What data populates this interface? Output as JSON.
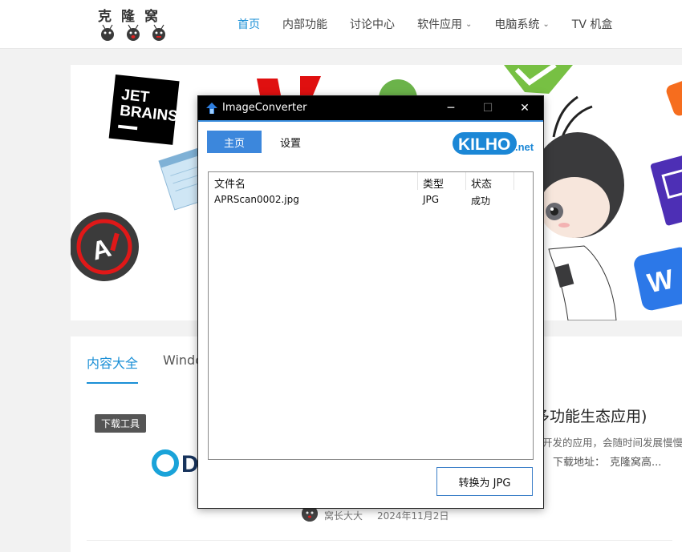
{
  "site": {
    "logo_text": "克隆窝",
    "nav": [
      {
        "label": "首页",
        "active": true
      },
      {
        "label": "内部功能"
      },
      {
        "label": "讨论中心"
      },
      {
        "label": "软件应用",
        "dropdown": true
      },
      {
        "label": "电脑系统",
        "dropdown": true
      },
      {
        "label": "TV 机盒"
      }
    ],
    "accent_color": "#1a8fd6"
  },
  "banner": {
    "icons": [
      "jetbrains-logo",
      "red-arrow-logo",
      "green-disc-icon",
      "green-check-icon",
      "orange-app-icon",
      "notepad-icon",
      "ai-circle-logo",
      "anime-mascot",
      "purple-chip-icon",
      "wps-office-icon"
    ],
    "jetbrains_line1": "JET",
    "jetbrains_line2": "BRAINS"
  },
  "content": {
    "tabs": [
      {
        "label": "内容大全",
        "active": true
      },
      {
        "label": "Windo"
      }
    ],
    "badge": "下载工具",
    "title_fragment": "多功能生态应用)",
    "desc_fragment": "开发的应用，会随时间发展慢慢",
    "download_label": "下载地址：",
    "download_link": "克隆窝高...",
    "author": "窝长大大",
    "date": "2024年11月2日",
    "logo_letter": "D"
  },
  "app": {
    "title": "ImageConverter",
    "title_buttons": {
      "minimize": "─",
      "maximize": "☐",
      "close": "✕"
    },
    "tabs": {
      "home": "主页",
      "settings": "设置"
    },
    "brand_logo": {
      "main": "KILHO",
      "suffix": ".net"
    },
    "table": {
      "columns": [
        "文件名",
        "类型",
        "状态"
      ],
      "rows": [
        {
          "filename": "APRScan0002.jpg",
          "type": "JPG",
          "status": "成功"
        }
      ]
    },
    "convert_button": "转换为 JPG",
    "accent_color": "#3c87dc"
  }
}
